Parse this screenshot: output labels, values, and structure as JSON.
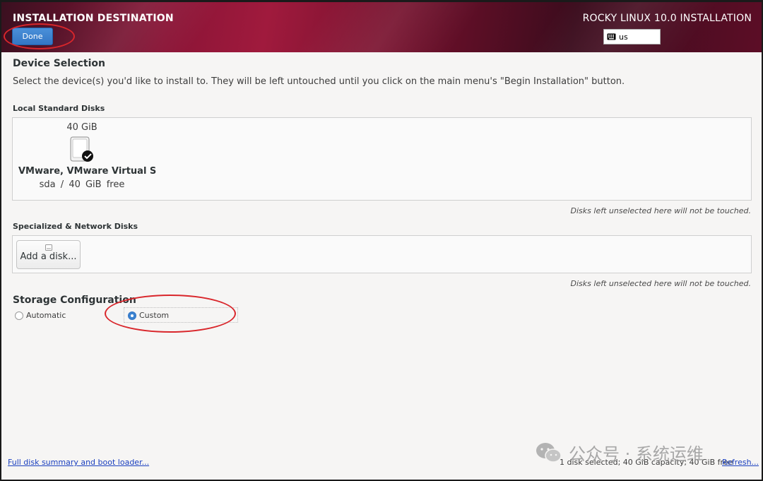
{
  "header": {
    "title": "INSTALLATION DESTINATION",
    "product": "ROCKY LINUX 10.0 INSTALLATION",
    "done_label": "Done",
    "keyboard_layout": "us"
  },
  "device_selection": {
    "heading": "Device Selection",
    "description": "Select the device(s) you'd like to install to.  They will be left untouched until you click on the main menu's \"Begin Installation\" button."
  },
  "local_disks": {
    "heading": "Local Standard Disks",
    "disks": [
      {
        "size": "40 GiB",
        "name": "VMware, VMware Virtual S",
        "device": "sda",
        "separator": "/",
        "free": "40 GiB free",
        "selected": true
      }
    ],
    "note": "Disks left unselected here will not be touched."
  },
  "network_disks": {
    "heading": "Specialized & Network Disks",
    "add_label": "Add a disk...",
    "note": "Disks left unselected here will not be touched."
  },
  "storage_config": {
    "heading": "Storage Configuration",
    "options": [
      {
        "label": "Automatic",
        "selected": false
      },
      {
        "label": "Custom",
        "selected": true
      }
    ]
  },
  "footer": {
    "summary_link": "Full disk summary and boot loader...",
    "status": "1 disk selected; 40 GiB capacity; 40 GiB free",
    "refresh_link": "Refresh..."
  },
  "watermark": {
    "text": "公众号 · 系统运维"
  },
  "colors": {
    "header_accent": "#8a1436",
    "done_button": "#3b82d0",
    "annotation_ring": "#d9262b",
    "link": "#1a3fbf"
  }
}
